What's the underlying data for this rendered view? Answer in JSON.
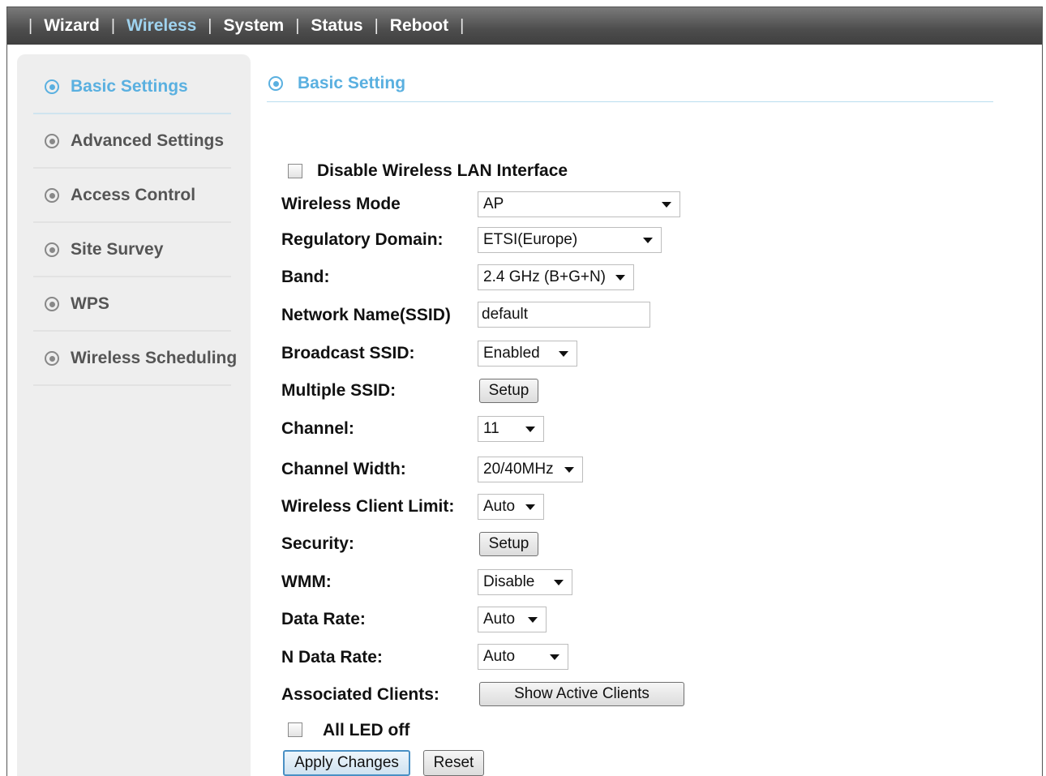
{
  "topnav": {
    "items": [
      {
        "label": "Wizard"
      },
      {
        "label": "Wireless"
      },
      {
        "label": "System"
      },
      {
        "label": "Status"
      },
      {
        "label": "Reboot"
      }
    ],
    "active": "Wireless",
    "separator": "|"
  },
  "sidebar": {
    "items": [
      {
        "label": "Basic Settings"
      },
      {
        "label": "Advanced Settings"
      },
      {
        "label": "Access Control"
      },
      {
        "label": "Site Survey"
      },
      {
        "label": "WPS"
      },
      {
        "label": "Wireless Scheduling"
      }
    ],
    "active": "Basic Settings"
  },
  "section": {
    "title": "Basic Setting"
  },
  "form": {
    "disable_wlan": {
      "label": "Disable Wireless LAN Interface",
      "checked": false
    },
    "wireless_mode": {
      "label": "Wireless Mode",
      "value": "AP"
    },
    "regulatory_domain": {
      "label": "Regulatory Domain:",
      "value": "ETSI(Europe)"
    },
    "band": {
      "label": "Band:",
      "value": "2.4 GHz (B+G+N)"
    },
    "ssid": {
      "label": "Network Name(SSID)",
      "value": "default"
    },
    "broadcast_ssid": {
      "label": "Broadcast SSID:",
      "value": "Enabled"
    },
    "multiple_ssid": {
      "label": "Multiple SSID:",
      "button": "Setup"
    },
    "channel": {
      "label": "Channel:",
      "value": "11"
    },
    "channel_width": {
      "label": "Channel Width:",
      "value": "20/40MHz"
    },
    "client_limit": {
      "label": "Wireless Client Limit:",
      "value": "Auto"
    },
    "security": {
      "label": "Security:",
      "button": "Setup"
    },
    "wmm": {
      "label": "WMM:",
      "value": "Disable"
    },
    "data_rate": {
      "label": "Data Rate:",
      "value": "Auto"
    },
    "n_data_rate": {
      "label": "N Data Rate:",
      "value": "Auto"
    },
    "associated_clients": {
      "label": "Associated Clients:",
      "button": "Show Active Clients"
    },
    "all_led_off": {
      "label": "All LED off",
      "checked": false
    },
    "apply_button": "Apply Changes",
    "reset_button": "Reset"
  },
  "colors": {
    "accent": "#5ab0e0",
    "nav_bg": "#4d4d4d"
  }
}
